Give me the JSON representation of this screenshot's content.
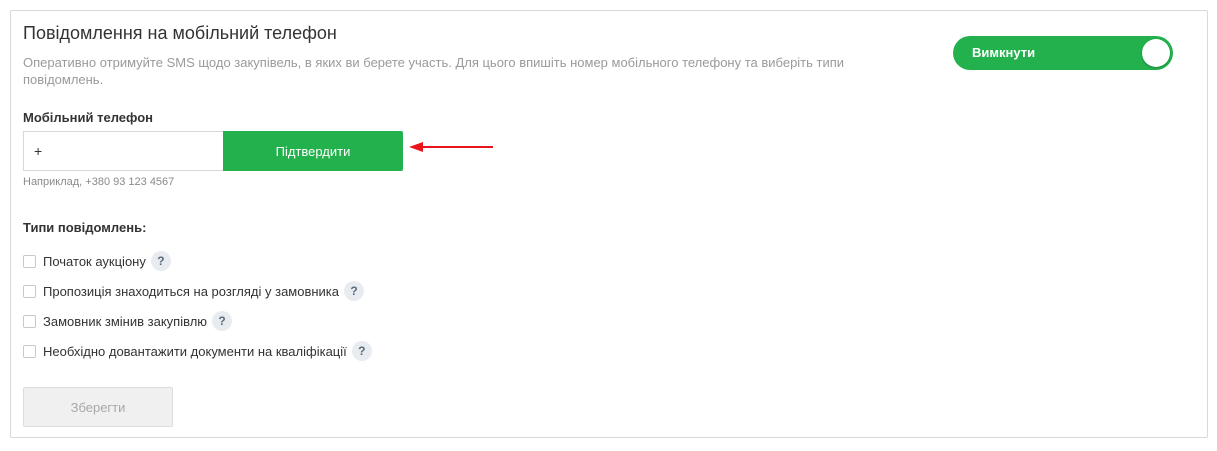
{
  "section": {
    "title": "Повідомлення на мобільний телефон",
    "description": "Оперативно отримуйте SMS щодо закупівель, в яких ви берете участь. Для цього впишіть номер мобільного телефону та виберіть типи повідомлень."
  },
  "toggle": {
    "label": "Вимкнути",
    "color": "#23b14d"
  },
  "phone": {
    "label": "Мобільний телефон",
    "value": "+",
    "hint": "Наприклад, +380 93 123 4567",
    "confirm_label": "Підтвердити"
  },
  "types": {
    "title": "Типи повідомлень:",
    "items": [
      {
        "label": "Початок аукціону",
        "help": "?"
      },
      {
        "label": "Пропозиція знаходиться на розгляді у замовника",
        "help": "?"
      },
      {
        "label": "Замовник змінив закупівлю",
        "help": "?"
      },
      {
        "label": "Необхідно довантажити документи на кваліфікації",
        "help": "?"
      }
    ]
  },
  "save_label": "Зберегти",
  "colors": {
    "accent": "#23b14d",
    "annotation_arrow": "#e8161b"
  }
}
